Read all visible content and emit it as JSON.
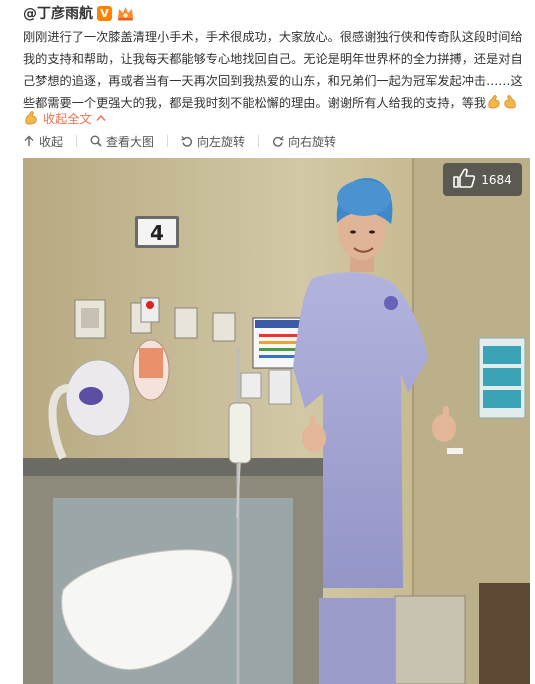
{
  "post": {
    "author": "@丁彦雨航",
    "verified_badge": "V",
    "text_lines": [
      "刚刚进行了一次膝盖清理小手术，手术很成功，大家放心。很感谢独行侠和传奇队这段时间给",
      "我的支持和帮助，让我每天都能够专心地找回自己。无论是明年世界杯的全力拼搏，还是对自",
      "己梦想的追逐，再或者当有一天再次回到我热爱的山东，和兄弟们一起为冠军发起冲击……这",
      "些都需要一个更强大的我，都是我时刻不能松懈的理由。谢谢所有人给我的支持，等我"
    ],
    "collapse_label": "收起全文",
    "collapse_icon": "chevron-up-icon"
  },
  "toolbar": {
    "items": [
      {
        "label": "收起",
        "icon": "collapse-up-icon"
      },
      {
        "label": "查看大图",
        "icon": "magnifier-icon"
      },
      {
        "label": "向左旋转",
        "icon": "rotate-left-icon"
      },
      {
        "label": "向右旋转",
        "icon": "rotate-right-icon"
      }
    ]
  },
  "photo": {
    "room_number": "4",
    "like_count": "1684",
    "like_icon": "thumbs-up-icon"
  },
  "colors": {
    "link_orange": "#eb7350",
    "verified_orange": "#ff8200",
    "text": "#333333",
    "gown": "#a5a6d3",
    "cap": "#3f88c9"
  }
}
